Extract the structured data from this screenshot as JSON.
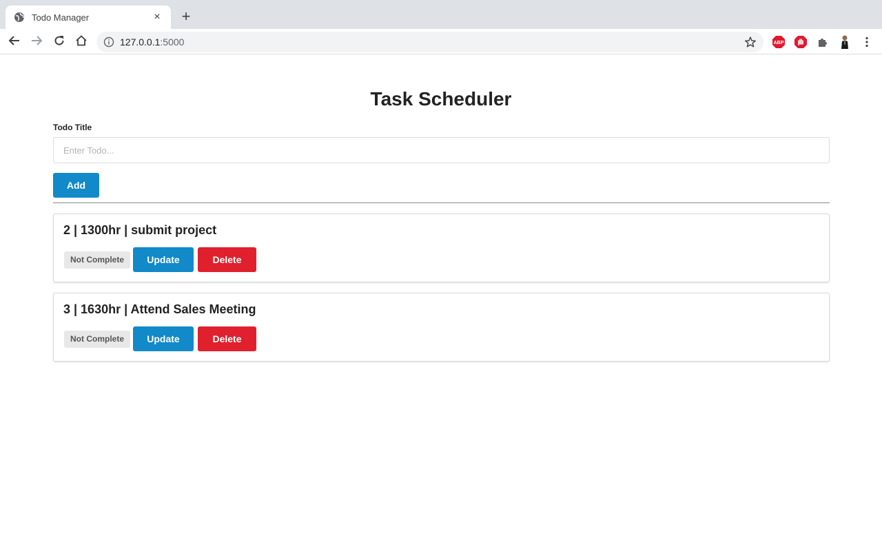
{
  "browser": {
    "tab_title": "Todo Manager",
    "tab_close": "×",
    "new_tab": "+",
    "url_host": "127.0.0.1",
    "url_port": ":5000",
    "extensions": {
      "abp_label": "ABP"
    }
  },
  "page": {
    "title": "Task Scheduler",
    "form": {
      "label": "Todo Title",
      "placeholder": "Enter Todo...",
      "value": "",
      "add_label": "Add"
    },
    "todos": [
      {
        "text": "2 | 1300hr | submit project",
        "status": "Not Complete",
        "update_label": "Update",
        "delete_label": "Delete"
      },
      {
        "text": "3 | 1630hr | Attend Sales Meeting",
        "status": "Not Complete",
        "update_label": "Update",
        "delete_label": "Delete"
      }
    ]
  },
  "colors": {
    "primary": "#1289c9",
    "danger": "#e0202d",
    "badge_bg": "#e8e8e8"
  }
}
